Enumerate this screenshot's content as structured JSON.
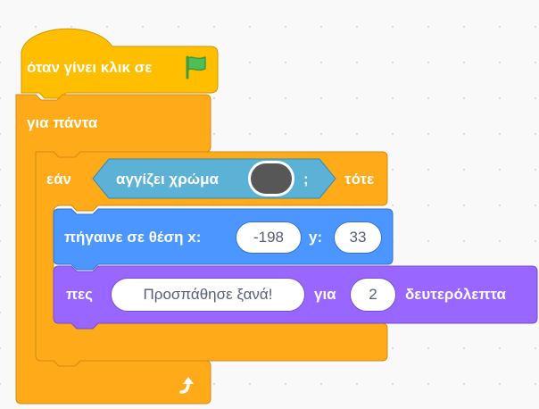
{
  "script": {
    "hat": {
      "label": "όταν γίνει κλικ σε",
      "icon": "green-flag-icon",
      "color": "#ffbf00"
    },
    "forever": {
      "label": "για πάντα",
      "icon": "loop-arrow-icon",
      "color": "#ffab19"
    },
    "if_block": {
      "if_label": "εάν",
      "then_label": "τότε",
      "condition": {
        "label": "αγγίζει χρώμα",
        "swatch_color": "#575757",
        "dropdown_symbol": ";",
        "color": "#5cb1d6"
      }
    },
    "goto_block": {
      "label": "πήγαινε σε θέση x:",
      "x_value": "-198",
      "y_label": "y:",
      "y_value": "33",
      "color": "#4c97ff"
    },
    "say_block": {
      "label": "πες",
      "message": "Προσπάθησε ξανά!",
      "for_label": "για",
      "seconds": "2",
      "unit_label": "δευτερόλεπτα",
      "color": "#9966ff"
    }
  }
}
